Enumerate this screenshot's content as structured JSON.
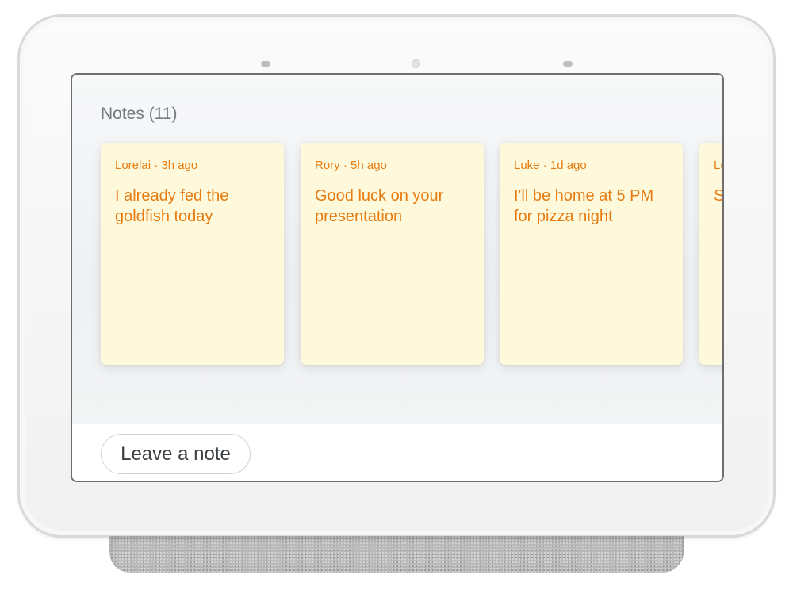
{
  "screen": {
    "title": "Notes (11)"
  },
  "notes": [
    {
      "meta": "Lorelai · 3h ago",
      "text": "I already fed the goldfish today"
    },
    {
      "meta": "Rory · 5h ago",
      "text": "Good luck on your presentation"
    },
    {
      "meta": "Luke · 1d ago",
      "text": "I'll be home at 5 PM for pizza night"
    },
    {
      "meta": "Lu",
      "text": "S ap"
    }
  ],
  "footer": {
    "leave_note_label": "Leave a note"
  },
  "colors": {
    "note_background": "#fff9dc",
    "note_text": "#e67c11",
    "title_text": "#717a82"
  }
}
